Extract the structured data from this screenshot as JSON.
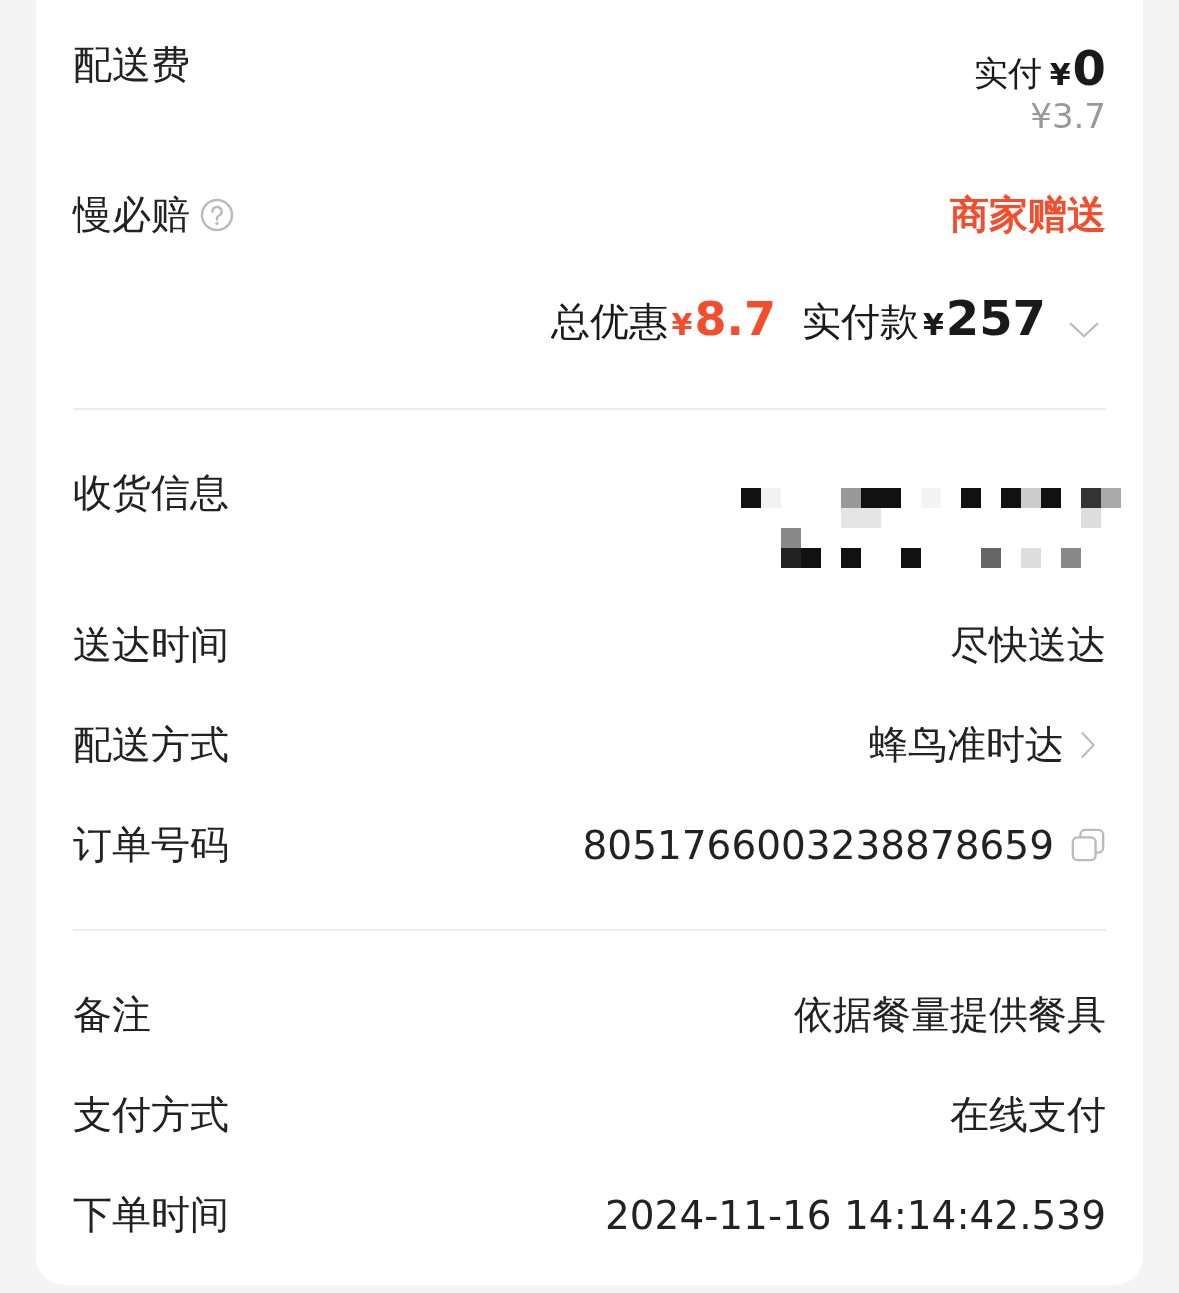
{
  "delivery_fee": {
    "label": "配送费",
    "paid_label": "实付",
    "paid_currency": "¥",
    "paid_amount": "0",
    "original_price": "¥3.7"
  },
  "slow_compensation": {
    "label": "慢必赔",
    "value": "商家赠送"
  },
  "summary": {
    "discount_label": "总优惠",
    "discount_currency": "¥",
    "discount_amount": "8.7",
    "paid_label": "实付款",
    "paid_currency": "¥",
    "paid_amount": "257",
    "expanded": false
  },
  "sections": [
    [
      {
        "kind": "redacted",
        "label": "收货信息"
      },
      {
        "kind": "text",
        "label": "送达时间",
        "value": "尽快送达"
      },
      {
        "kind": "link",
        "label": "配送方式",
        "value": "蜂鸟准时达"
      },
      {
        "kind": "copy",
        "label": "订单号码",
        "value": "8051766003238878659"
      }
    ],
    [
      {
        "kind": "text",
        "label": "备注",
        "value": "依据餐量提供餐具"
      },
      {
        "kind": "text",
        "label": "支付方式",
        "value": "在线支付"
      },
      {
        "kind": "text",
        "label": "下单时间",
        "value": "2024-11-16 14:14:42.539"
      }
    ]
  ]
}
